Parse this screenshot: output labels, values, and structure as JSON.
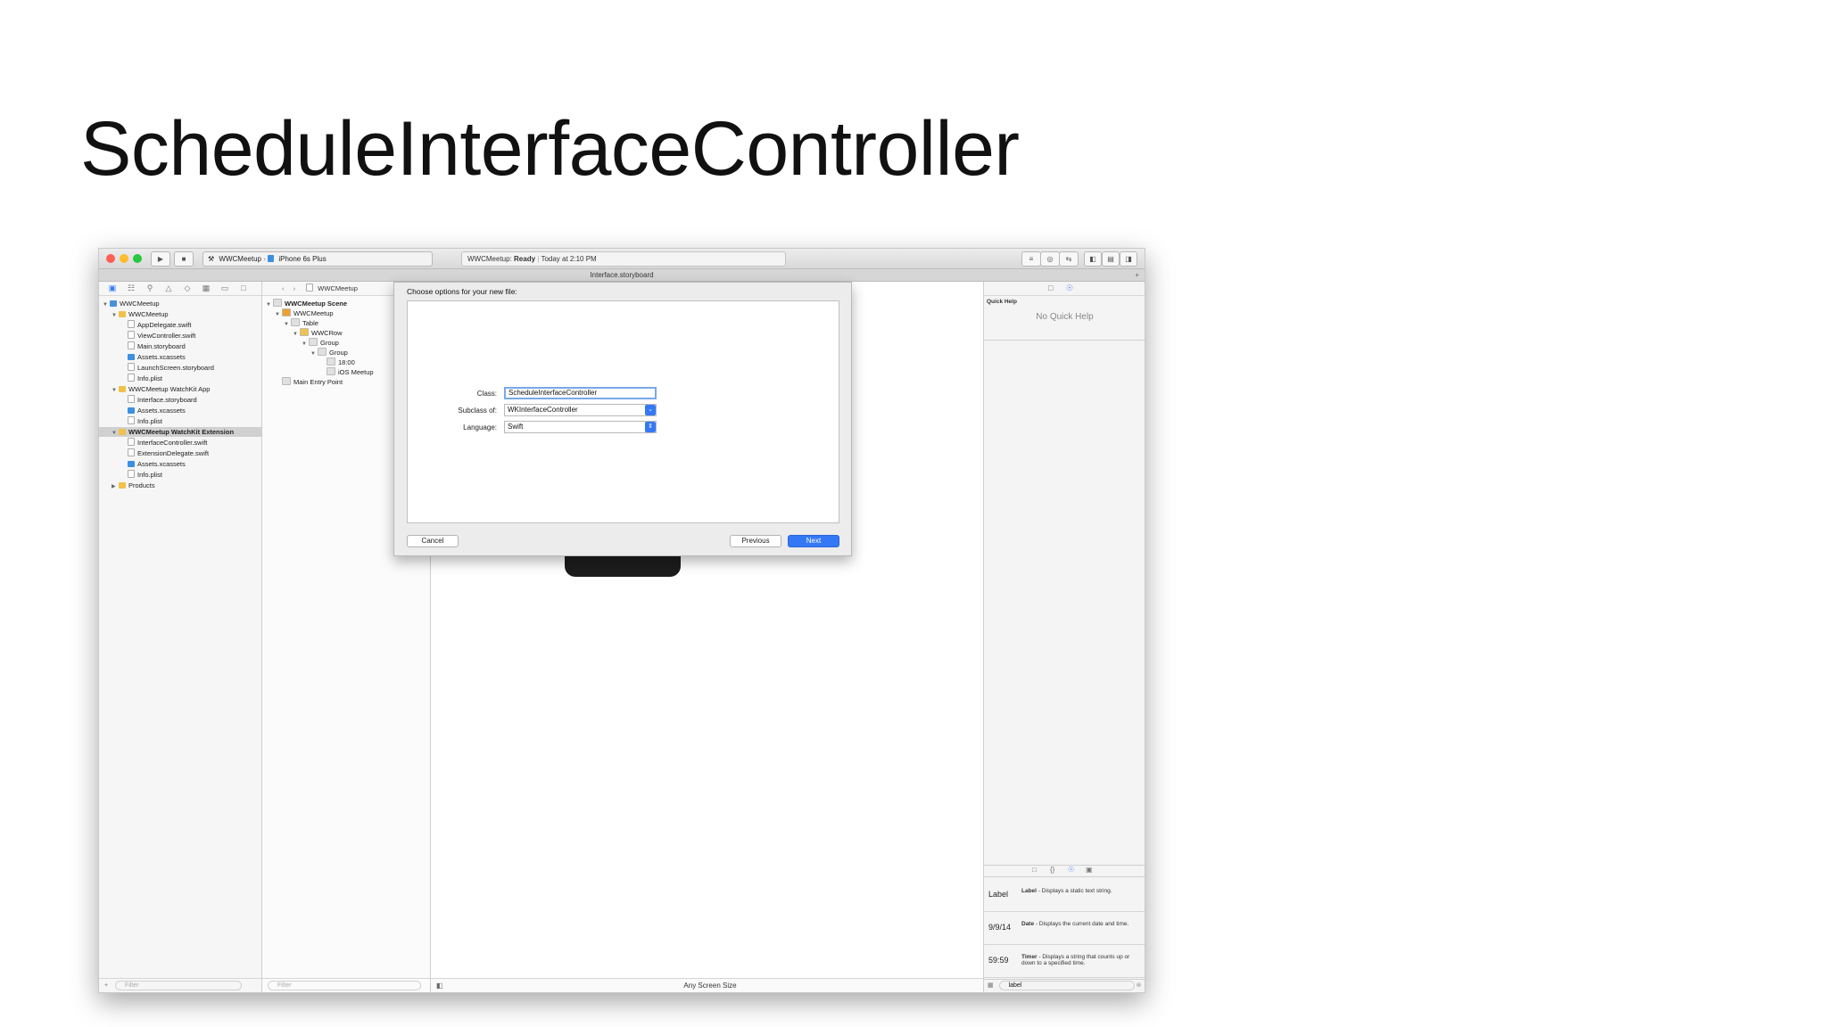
{
  "slide": {
    "title": "ScheduleInterfaceController"
  },
  "toolbar": {
    "scheme": "WWCMeetup",
    "device": "iPhone 6s Plus",
    "status_project": "WWCMeetup:",
    "status_state": "Ready",
    "status_time": "Today at 2:10 PM"
  },
  "tab": {
    "title": "Interface.storyboard"
  },
  "navigator": {
    "items": [
      {
        "label": "WWCMeetup",
        "depth": 0,
        "icon": "proj"
      },
      {
        "label": "WWCMeetup",
        "depth": 1,
        "icon": "folder"
      },
      {
        "label": "AppDelegate.swift",
        "depth": 2,
        "icon": "file"
      },
      {
        "label": "ViewController.swift",
        "depth": 2,
        "icon": "file"
      },
      {
        "label": "Main.storyboard",
        "depth": 2,
        "icon": "file"
      },
      {
        "label": "Assets.xcassets",
        "depth": 2,
        "icon": "blue"
      },
      {
        "label": "LaunchScreen.storyboard",
        "depth": 2,
        "icon": "file"
      },
      {
        "label": "Info.plist",
        "depth": 2,
        "icon": "file"
      },
      {
        "label": "WWCMeetup WatchKit App",
        "depth": 1,
        "icon": "folder"
      },
      {
        "label": "Interface.storyboard",
        "depth": 2,
        "icon": "file"
      },
      {
        "label": "Assets.xcassets",
        "depth": 2,
        "icon": "blue"
      },
      {
        "label": "Info.plist",
        "depth": 2,
        "icon": "file"
      },
      {
        "label": "WWCMeetup WatchKit Extension",
        "depth": 1,
        "icon": "folder",
        "selected": true
      },
      {
        "label": "InterfaceController.swift",
        "depth": 2,
        "icon": "file"
      },
      {
        "label": "ExtensionDelegate.swift",
        "depth": 2,
        "icon": "file"
      },
      {
        "label": "Assets.xcassets",
        "depth": 2,
        "icon": "blue"
      },
      {
        "label": "Info.plist",
        "depth": 2,
        "icon": "file"
      },
      {
        "label": "Products",
        "depth": 1,
        "icon": "folder"
      }
    ],
    "filter_placeholder": "Filter"
  },
  "outline": {
    "jump_bar": "WWCMeetup",
    "items": [
      {
        "label": "WWCMeetup Scene",
        "depth": 0,
        "bold": true
      },
      {
        "label": "WWCMeetup",
        "depth": 1
      },
      {
        "label": "Table",
        "depth": 2
      },
      {
        "label": "WWCRow",
        "depth": 3
      },
      {
        "label": "Group",
        "depth": 4
      },
      {
        "label": "Group",
        "depth": 5
      },
      {
        "label": "18:00",
        "depth": 6
      },
      {
        "label": "iOS Meetup",
        "depth": 6
      },
      {
        "label": "Main Entry Point",
        "depth": 1
      }
    ],
    "filter_placeholder": "Filter"
  },
  "canvas": {
    "size_label": "Any Screen Size"
  },
  "inspector": {
    "section_title": "Quick Help",
    "empty_text": "No Quick Help",
    "library": [
      {
        "preview": "Label",
        "name": "Label",
        "desc": "- Displays a static text string."
      },
      {
        "preview": "9/9/14",
        "name": "Date",
        "desc": "- Displays the current date and time."
      },
      {
        "preview": "59:59",
        "name": "Timer",
        "desc": "- Displays a string that counts up or down to a specified time."
      }
    ],
    "search_value": "label"
  },
  "dialog": {
    "title": "Choose options for your new file:",
    "class_label": "Class:",
    "class_value": "ScheduleInterfaceController",
    "subclass_label": "Subclass of:",
    "subclass_value": "WKInterfaceController",
    "language_label": "Language:",
    "language_value": "Swift",
    "cancel": "Cancel",
    "previous": "Previous",
    "next": "Next"
  },
  "colors": {
    "accent": "#3478f6",
    "folder": "#f0c24b"
  }
}
